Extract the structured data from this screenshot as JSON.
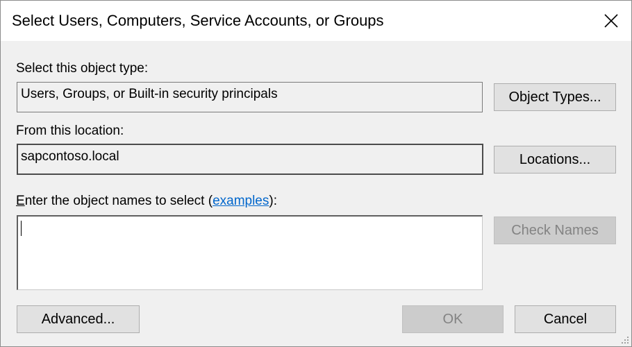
{
  "window": {
    "title": "Select Users, Computers, Service Accounts, or Groups",
    "close_icon": "close-icon"
  },
  "object_type": {
    "label": "Select this object type:",
    "value": "Users, Groups, or Built-in security principals",
    "button_label": "Object Types..."
  },
  "location": {
    "label": "From this location:",
    "value": "sapcontoso.local",
    "button_label": "Locations..."
  },
  "object_names": {
    "label_accel": "E",
    "label_before_link": "nter the object names to select (",
    "link_text": "examples",
    "label_after_link": "):",
    "value": "",
    "check_names_label": "Check Names"
  },
  "footer": {
    "advanced_label": "Advanced...",
    "ok_label": "OK",
    "cancel_label": "Cancel"
  },
  "colors": {
    "dialog_bg": "#f0f0f0",
    "link": "#0066cc",
    "disabled_text": "#838383"
  }
}
